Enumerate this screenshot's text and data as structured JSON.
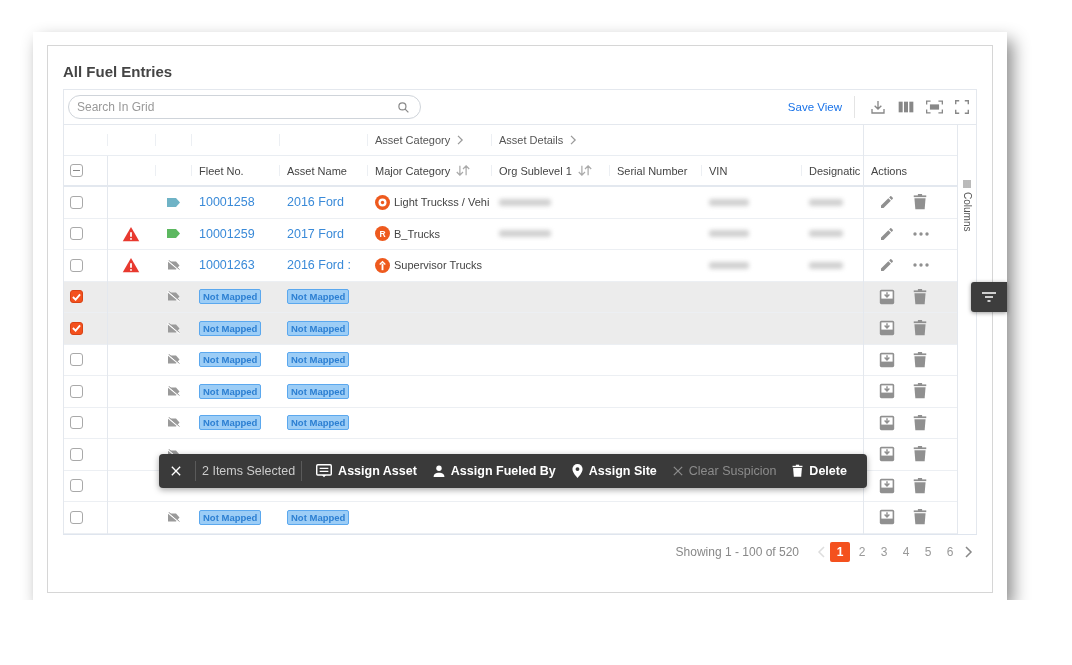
{
  "card": {
    "title": "All Fuel Entries"
  },
  "toolbar": {
    "search_placeholder": "Search In Grid",
    "save_view": "Save View"
  },
  "column_groups": [
    {
      "label": "Asset Category"
    },
    {
      "label": "Asset Details"
    }
  ],
  "columns": [
    {
      "kind": "check",
      "indeterminate": true
    },
    {
      "kind": "blank"
    },
    {
      "kind": "blank"
    },
    {
      "kind": "text",
      "label": "Fleet No."
    },
    {
      "kind": "text",
      "label": "Asset Name"
    },
    {
      "kind": "sort",
      "label": "Major Category"
    },
    {
      "kind": "sort",
      "label": "Org Sublevel 1"
    },
    {
      "kind": "text",
      "label": "Serial Number"
    },
    {
      "kind": "text",
      "label": "VIN"
    },
    {
      "kind": "text",
      "label": "Designatic"
    },
    {
      "kind": "text",
      "label": "Actions"
    }
  ],
  "side_panel": {
    "label": "Columns"
  },
  "rows": [
    {
      "selected": false,
      "alert": false,
      "tag": {
        "kind": "label",
        "color": "#6fb3c6"
      },
      "fleet_no": {
        "kind": "link",
        "text": "10001258"
      },
      "asset_name": {
        "kind": "link",
        "text": "2016 Ford"
      },
      "category": {
        "kind": "ring",
        "label": "Light Truckss / Vehi"
      },
      "org": {
        "kind": "blurred"
      },
      "vin": {
        "kind": "blurred"
      },
      "designation": {
        "kind": "blurred"
      },
      "actions": [
        {
          "kind": "edit"
        },
        {
          "kind": "delete"
        }
      ]
    },
    {
      "selected": false,
      "alert": true,
      "tag": {
        "kind": "label",
        "color": "#5cb860"
      },
      "fleet_no": {
        "kind": "link",
        "text": "10001259"
      },
      "asset_name": {
        "kind": "link",
        "text": "2017 Ford"
      },
      "category": {
        "kind": "letter",
        "letter": "R",
        "label": "B_Trucks"
      },
      "org": {
        "kind": "blurred"
      },
      "vin": {
        "kind": "blurred"
      },
      "designation": {
        "kind": "blurred"
      },
      "actions": [
        {
          "kind": "edit"
        },
        {
          "kind": "more"
        }
      ]
    },
    {
      "selected": false,
      "alert": true,
      "tag": {
        "kind": "unlinked"
      },
      "fleet_no": {
        "kind": "link",
        "text": "10001263"
      },
      "asset_name": {
        "kind": "link",
        "text": "2016 Ford :"
      },
      "category": {
        "kind": "info",
        "label": "Supervisor Trucks"
      },
      "vin": {
        "kind": "blurred"
      },
      "designation": {
        "kind": "blurred"
      },
      "actions": [
        {
          "kind": "edit"
        },
        {
          "kind": "more"
        }
      ]
    },
    {
      "selected": true,
      "alert": false,
      "tag": {
        "kind": "unlinked"
      },
      "fleet_no": {
        "kind": "badge",
        "text": "Not Mapped"
      },
      "asset_name": {
        "kind": "badge",
        "text": "Not Mapped"
      },
      "actions": [
        {
          "kind": "import"
        },
        {
          "kind": "delete"
        }
      ]
    },
    {
      "selected": true,
      "alert": false,
      "tag": {
        "kind": "unlinked"
      },
      "fleet_no": {
        "kind": "badge",
        "text": "Not Mapped"
      },
      "asset_name": {
        "kind": "badge",
        "text": "Not Mapped"
      },
      "actions": [
        {
          "kind": "import"
        },
        {
          "kind": "delete"
        }
      ]
    },
    {
      "selected": false,
      "alert": false,
      "tag": {
        "kind": "unlinked"
      },
      "fleet_no": {
        "kind": "badge",
        "text": "Not Mapped"
      },
      "asset_name": {
        "kind": "badge",
        "text": "Not Mapped"
      },
      "actions": [
        {
          "kind": "import"
        },
        {
          "kind": "delete"
        }
      ]
    },
    {
      "selected": false,
      "alert": false,
      "tag": {
        "kind": "unlinked"
      },
      "fleet_no": {
        "kind": "badge",
        "text": "Not Mapped"
      },
      "asset_name": {
        "kind": "badge",
        "text": "Not Mapped"
      },
      "actions": [
        {
          "kind": "import"
        },
        {
          "kind": "delete"
        }
      ]
    },
    {
      "selected": false,
      "alert": false,
      "tag": {
        "kind": "unlinked"
      },
      "fleet_no": {
        "kind": "badge",
        "text": "Not Mapped"
      },
      "asset_name": {
        "kind": "badge",
        "text": "Not Mapped"
      },
      "actions": [
        {
          "kind": "import"
        },
        {
          "kind": "delete"
        }
      ]
    },
    {
      "selected": false,
      "alert": false,
      "tag": {
        "kind": "unlinked"
      },
      "actions": [
        {
          "kind": "import"
        },
        {
          "kind": "delete"
        }
      ]
    },
    {
      "selected": false,
      "alert": false,
      "actions": [
        {
          "kind": "import"
        },
        {
          "kind": "delete"
        }
      ]
    },
    {
      "selected": false,
      "alert": false,
      "tag": {
        "kind": "unlinked"
      },
      "fleet_no": {
        "kind": "badge",
        "text": "Not Mapped"
      },
      "asset_name": {
        "kind": "badge",
        "text": "Not Mapped"
      },
      "actions": [
        {
          "kind": "import"
        },
        {
          "kind": "delete"
        }
      ]
    }
  ],
  "bulk_bar": {
    "count": "2 Items Selected",
    "actions": [
      {
        "kind": "assign_asset",
        "label": "Assign Asset",
        "disabled": false
      },
      {
        "kind": "assign_person",
        "label": "Assign Fueled By",
        "disabled": false
      },
      {
        "kind": "assign_site",
        "label": "Assign Site",
        "disabled": false
      },
      {
        "kind": "clear",
        "label": "Clear Suspicion",
        "disabled": true
      },
      {
        "kind": "delete",
        "label": "Delete",
        "disabled": false
      }
    ]
  },
  "pagination": {
    "summary": "Showing 1 - 100 of 520",
    "prev_disabled": true,
    "pages": [
      {
        "label": "1",
        "selected": true
      },
      {
        "label": "2",
        "selected": false
      },
      {
        "label": "3",
        "selected": false
      },
      {
        "label": "4",
        "selected": false
      },
      {
        "label": "5",
        "selected": false
      },
      {
        "label": "6",
        "selected": false
      }
    ]
  }
}
